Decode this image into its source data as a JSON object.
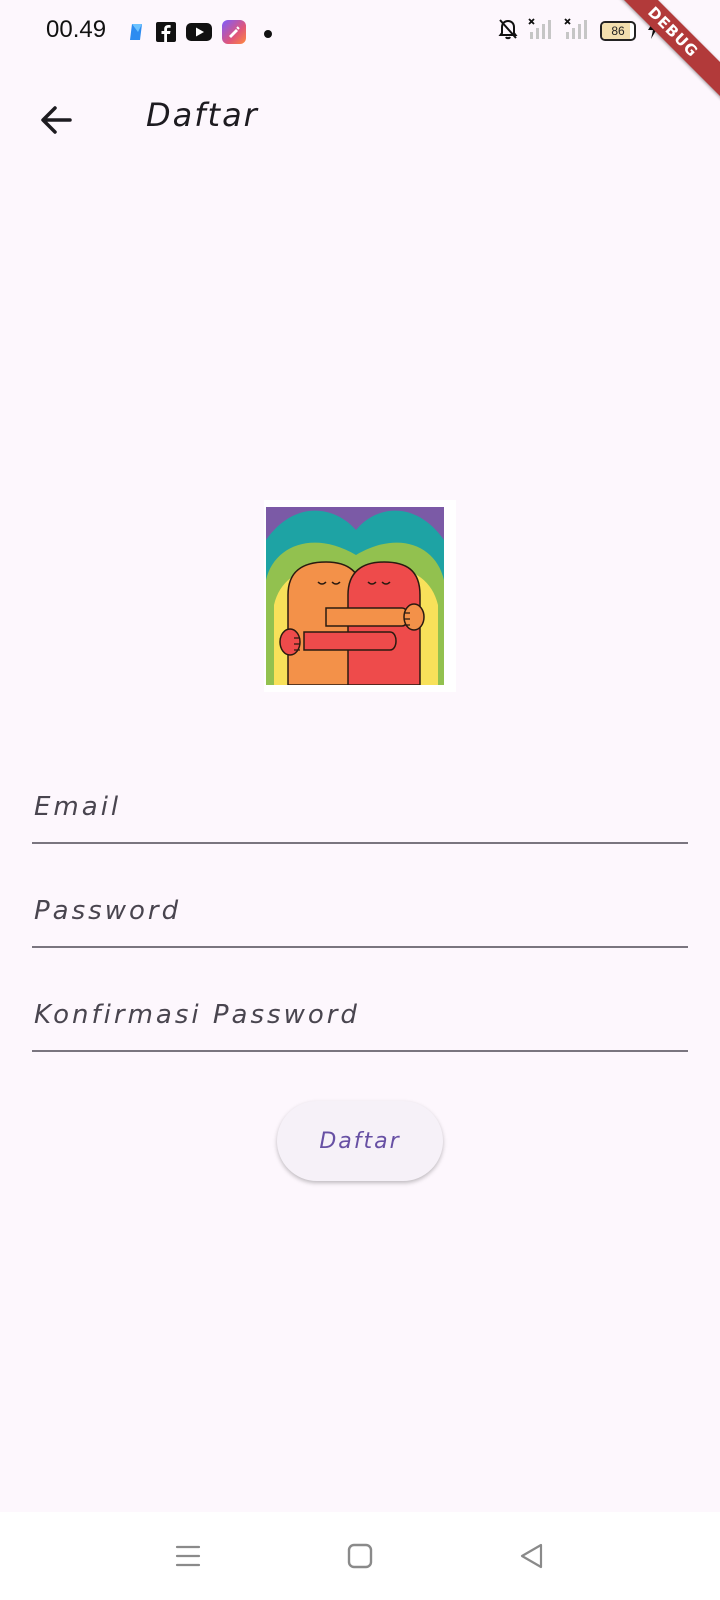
{
  "status_bar": {
    "time": "00.49",
    "battery_level": "86",
    "debug_label": "DEBUG",
    "notification_icons": [
      "app-icon",
      "facebook-icon",
      "youtube-icon",
      "app-icon"
    ],
    "system_icons": [
      "bell-off-icon",
      "signal-icon",
      "signal-icon",
      "battery-icon",
      "charging-icon"
    ]
  },
  "app_bar": {
    "title": "Daftar",
    "back_icon": "arrow-back-icon"
  },
  "form": {
    "email_placeholder": "Email",
    "password_placeholder": "Password",
    "confirm_placeholder": "Konfirmasi Password",
    "submit_label": "Daftar"
  },
  "navigation": {
    "icons": [
      "menu-icon",
      "square-home-icon",
      "triangle-back-icon"
    ]
  },
  "colors": {
    "background": "#fdf7fd",
    "accent": "#6750a4",
    "underline": "#7a757f",
    "debug_banner": "#b23a3a"
  }
}
